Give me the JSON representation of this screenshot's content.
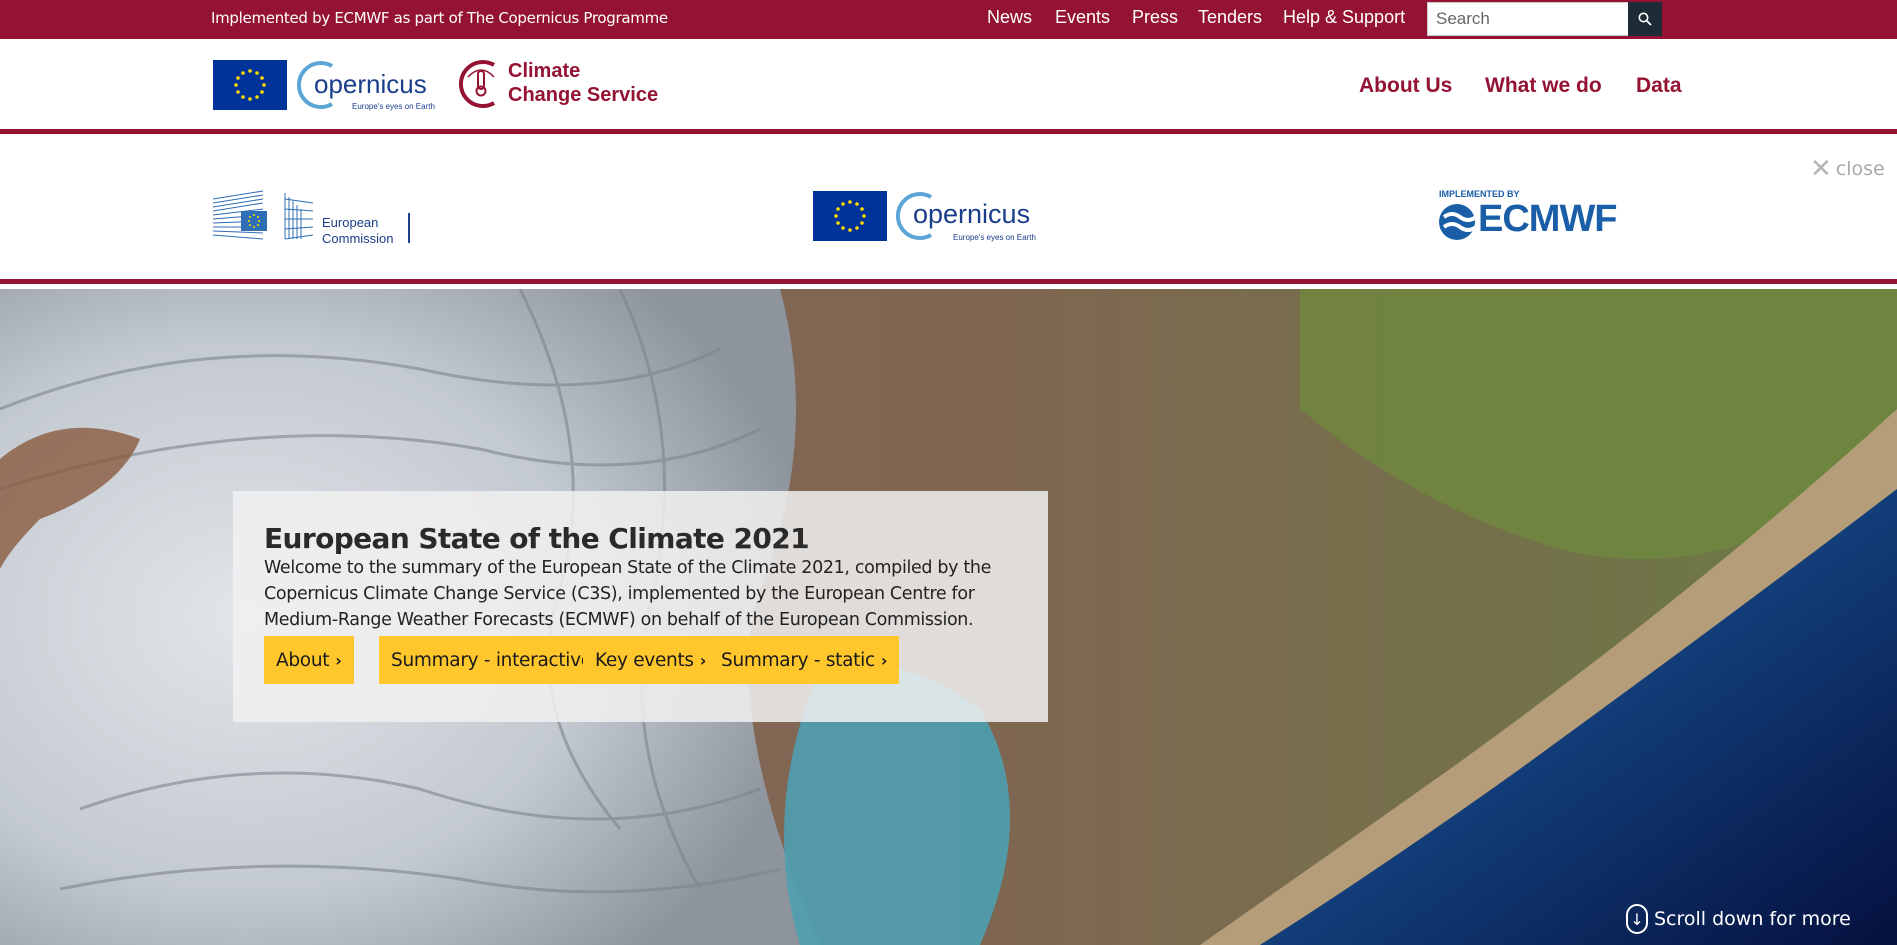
{
  "topbar": {
    "implemented_text": "Implemented by ECMWF as part of The Copernicus Programme",
    "links": [
      "News",
      "Events",
      "Press",
      "Tenders",
      "Help & Support"
    ],
    "search_placeholder": "Search",
    "background_color": "#941333"
  },
  "header": {
    "copernicus_word": "opernicus",
    "copernicus_tagline": "Europe's eyes on Earth",
    "c3s_line1": "Climate",
    "c3s_line2": "Change Service",
    "nav": [
      "About Us",
      "What we do",
      "Data"
    ]
  },
  "partners": {
    "ec_line1": "European",
    "ec_line2": "Commission",
    "copernicus_word": "opernicus",
    "copernicus_tagline": "Europe's eyes on Earth",
    "ecmwf_small": "IMPLEMENTED BY",
    "ecmwf_name": "ECMWF",
    "close_label": "close"
  },
  "hero": {
    "title": "European State of the Climate 2021",
    "description": "Welcome to the summary of the European State of the Climate 2021, compiled by the Copernicus Climate Change Service (C3S), implemented by the European Centre for Medium-Range Weather Forecasts (ECMWF) on behalf of the European Commission.",
    "buttons": [
      "About",
      "Summary - interactive",
      "Key events",
      "Summary - static"
    ],
    "button_color": "#ffc72c",
    "scroll_label": "Scroll down for more"
  }
}
